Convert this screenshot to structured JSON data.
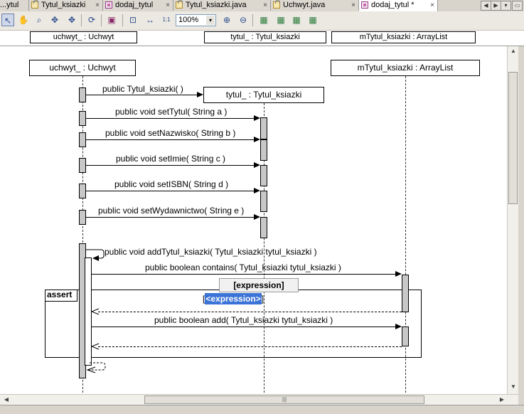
{
  "tabs": [
    {
      "label": "...ytul"
    },
    {
      "label": "Tytul_ksiazki"
    },
    {
      "label": "dodaj_tytul"
    },
    {
      "label": "Tytul_ksiazki.java"
    },
    {
      "label": "Uchwyt.java"
    },
    {
      "label": "dodaj_tytul *"
    }
  ],
  "tab_close_symbol": "×",
  "nav_buttons": {
    "left": "◀",
    "right": "▶",
    "list": "▾",
    "window": "▭"
  },
  "toolbar": {
    "zoom_value": "100%",
    "zoom_arrow": "▾",
    "icons": [
      "select-icon",
      "hand-icon",
      "zoom-icon",
      "navigate-icon",
      "refresh-icon",
      "export-icon",
      "fit-icon",
      "fit-width-icon",
      "actual-size-icon",
      "zoom-in-icon",
      "zoom-out-icon",
      "layout-1-icon",
      "layout-2-icon",
      "layout-3-icon",
      "layout-4-icon"
    ],
    "glyphs": {
      "select": "↖",
      "hand": "✋",
      "zoom": "⌕",
      "navigate": "✥",
      "refresh": "⟳",
      "export": "▣",
      "fit": "⊡",
      "fit_width": "↔",
      "actual_size": "1:1",
      "zoom_in": "⊕",
      "zoom_out": "⊖",
      "layout1": "▦",
      "layout2": "▦",
      "layout3": "▦",
      "layout4": "▦"
    }
  },
  "header_lifelines": [
    {
      "label": "uchwyt_ : Uchwyt"
    },
    {
      "label": "tytul_ : Tytul_ksiazki"
    },
    {
      "label": "mTytul_ksiazki : ArrayList"
    }
  ],
  "objects": {
    "uchwyt": "uchwyt_ : Uchwyt",
    "tytul": "tytul_ : Tytul_ksiazki",
    "mtytul": "mTytul_ksiazki : ArrayList"
  },
  "messages": [
    {
      "label": "public Tytul_ksiazki(  )"
    },
    {
      "label": "public void  setTytul( String a )"
    },
    {
      "label": "public void  setNazwisko( String b )"
    },
    {
      "label": "public void  setImie( String c )"
    },
    {
      "label": "public void  setISBN( String d )"
    },
    {
      "label": "public void  setWydawnictwo( String e )"
    },
    {
      "label": "public void  addTytul_ksiazki( Tytul_ksiazki tytul_ksiazki )"
    },
    {
      "label": "public boolean  contains( Tytul_ksiazki tytul_ksiazki )"
    },
    {
      "label": "public boolean  add( Tytul_ksiazki tytul_ksiazki )"
    }
  ],
  "fragment": {
    "operator": "assert",
    "guard_tooltip": "[expression]",
    "guard_edit": "<expression>",
    "guard_edit_bracket_left": "[",
    "guard_edit_bracket_right": "]"
  },
  "scrollbars": {
    "up": "▲",
    "down": "▼",
    "left": "◀",
    "right": "▶",
    "grip": "|||"
  },
  "colors": {
    "selection": "#3b73d6",
    "activation": "#c8c8c8"
  }
}
